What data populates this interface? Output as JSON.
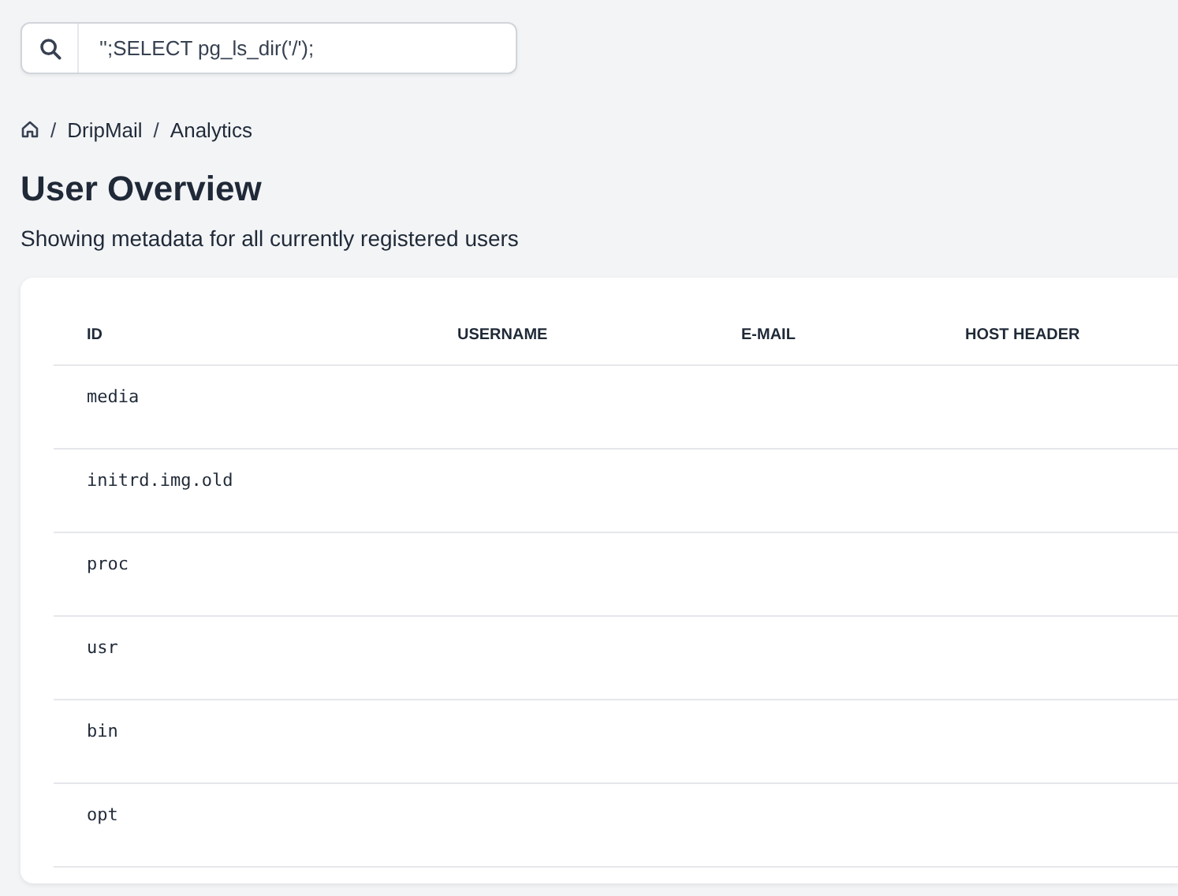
{
  "search": {
    "value": "'';SELECT pg_ls_dir('/');"
  },
  "breadcrumb": [
    {
      "separator": "/",
      "label": "DripMail"
    },
    {
      "separator": "/",
      "label": "Analytics"
    }
  ],
  "page": {
    "title": "User Overview",
    "subtitle": "Showing metadata for all currently registered users"
  },
  "table": {
    "columns": [
      "ID",
      "USERNAME",
      "E-MAIL",
      "HOST HEADER"
    ],
    "rows": [
      [
        "media"
      ],
      [
        "initrd.img.old"
      ],
      [
        "proc"
      ],
      [
        "usr"
      ],
      [
        "bin"
      ],
      [
        "opt"
      ]
    ]
  }
}
